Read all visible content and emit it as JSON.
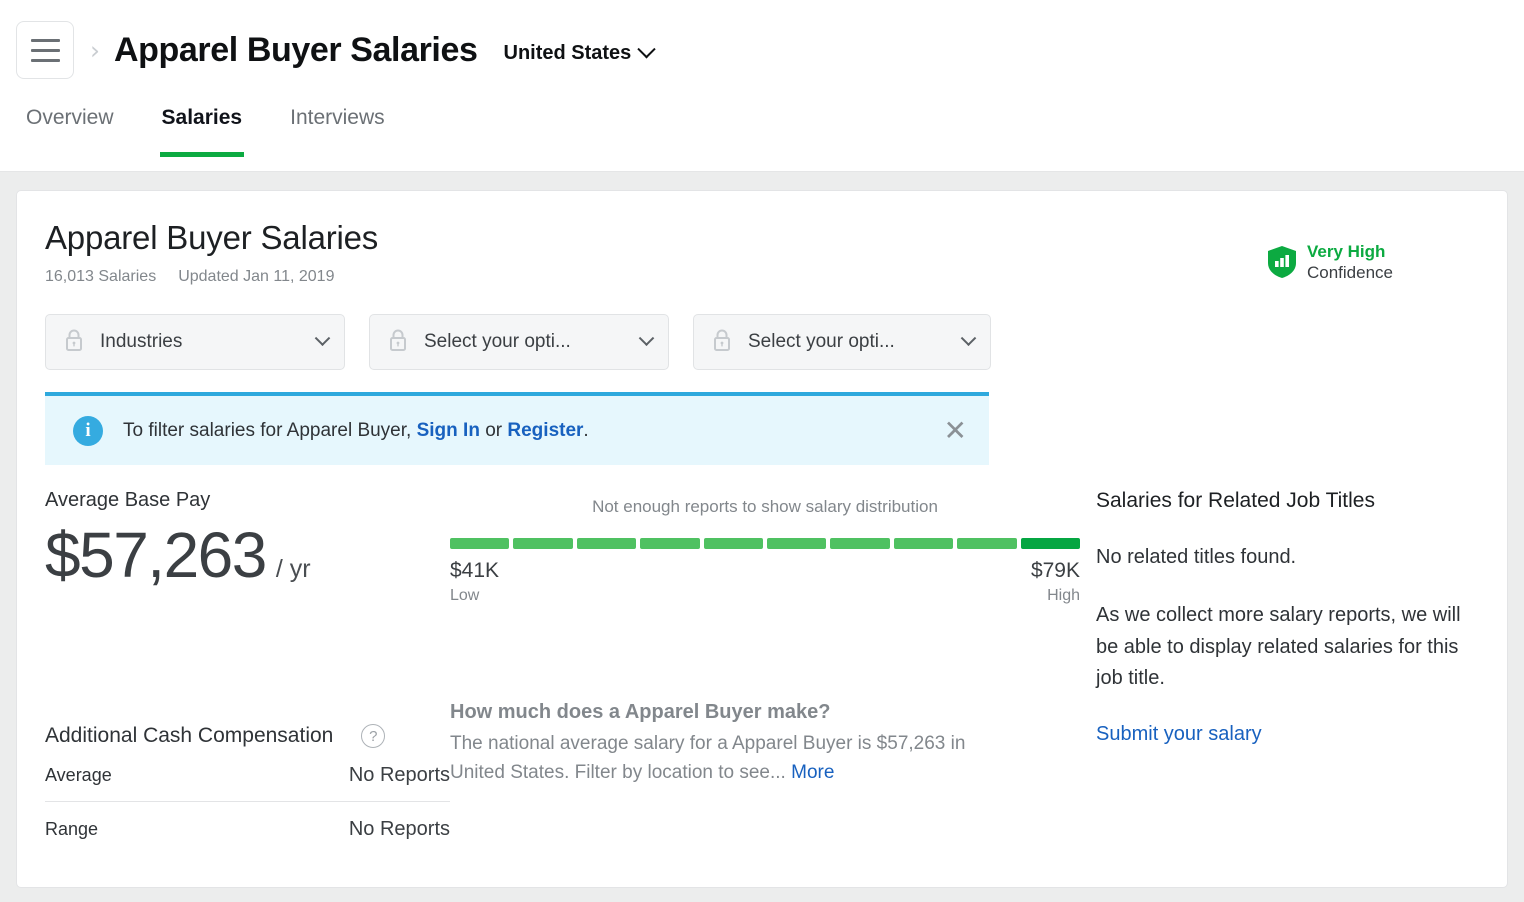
{
  "header": {
    "menu_icon": "hamburger-icon",
    "breadcrumb_separator": "›",
    "title": "Apparel Buyer Salaries",
    "locale": "United States",
    "locale_chevron": "chevron-down-icon"
  },
  "tabs": [
    {
      "label": "Overview",
      "active": false
    },
    {
      "label": "Salaries",
      "active": true
    },
    {
      "label": "Interviews",
      "active": false
    }
  ],
  "card": {
    "title": "Apparel Buyer Salaries",
    "salary_count": "16,013 Salaries",
    "updated": "Updated Jan 11, 2019",
    "confidence": {
      "level": "Very High",
      "label": "Confidence",
      "icon": "shield-bar-chart-icon",
      "color": "#0caa41"
    }
  },
  "filters": [
    {
      "label": "Industries",
      "icon": "lock-icon"
    },
    {
      "label": "Select your opti...",
      "icon": "lock-icon"
    },
    {
      "label": "Select your opti...",
      "icon": "lock-icon"
    }
  ],
  "banner": {
    "icon": "info-icon",
    "text_before": "To filter salaries for Apparel Buyer,",
    "link_signin": "Sign In",
    "text_or": "or",
    "link_register": "Register",
    "text_end": ".",
    "close_icon": "close-icon",
    "accent_color": "#2ea9dd",
    "background_color": "#e6f7fd"
  },
  "average_pay": {
    "label": "Average Base Pay",
    "amount": "$57,263",
    "per": "/ yr"
  },
  "additional_cash": {
    "title": "Additional Cash Compensation",
    "help_icon": "question-mark-icon",
    "rows": [
      {
        "label": "Average",
        "value": "No Reports"
      },
      {
        "label": "Range",
        "value": "No Reports"
      }
    ]
  },
  "distribution": {
    "note": "Not enough reports to show salary distribution",
    "low_value": "$41K",
    "low_label": "Low",
    "high_value": "$79K",
    "high_label": "High"
  },
  "how_much": {
    "question": "How much does a Apparel Buyer make?",
    "answer": "The national average salary for a Apparel Buyer is $57,263 in United States. Filter by location to see...",
    "more_link": "More"
  },
  "related": {
    "title": "Salaries for Related Job Titles",
    "empty": "No related titles found.",
    "copy": "As we collect more salary reports, we will be able to display related salaries for this job title.",
    "submit_link": "Submit your salary"
  },
  "chart_data": {
    "type": "bar",
    "title": "Salary distribution range",
    "subtitle": "Not enough reports to show salary distribution",
    "categories": [
      "1",
      "2",
      "3",
      "4",
      "5",
      "6",
      "7",
      "8",
      "9",
      "10"
    ],
    "values": [
      1,
      1,
      1,
      1,
      1,
      1,
      1,
      1,
      1,
      1
    ],
    "segment_colors": [
      "#4fc161",
      "#4fc161",
      "#4fc161",
      "#4fc161",
      "#4fc161",
      "#4fc161",
      "#4fc161",
      "#4fc161",
      "#4fc161",
      "#05a642"
    ],
    "xlabel": "",
    "ylabel": "",
    "axis_min_label": "$41K",
    "axis_max_label": "$79K",
    "axis_min_caption": "Low",
    "axis_max_caption": "High",
    "grid": false,
    "legend": "none"
  }
}
